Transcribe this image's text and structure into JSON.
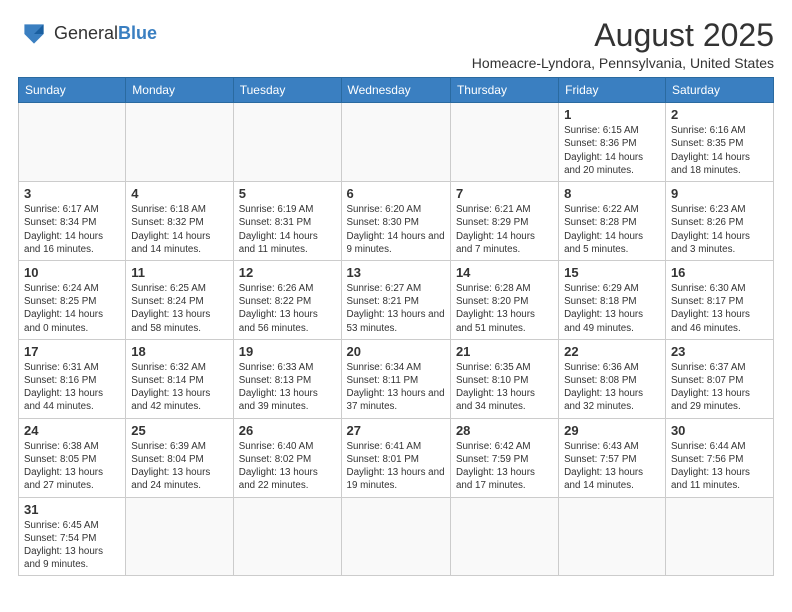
{
  "header": {
    "logo_general": "General",
    "logo_blue": "Blue",
    "month_year": "August 2025",
    "location": "Homeacre-Lyndora, Pennsylvania, United States"
  },
  "days_of_week": [
    "Sunday",
    "Monday",
    "Tuesday",
    "Wednesday",
    "Thursday",
    "Friday",
    "Saturday"
  ],
  "weeks": [
    [
      {
        "day": "",
        "info": ""
      },
      {
        "day": "",
        "info": ""
      },
      {
        "day": "",
        "info": ""
      },
      {
        "day": "",
        "info": ""
      },
      {
        "day": "",
        "info": ""
      },
      {
        "day": "1",
        "info": "Sunrise: 6:15 AM\nSunset: 8:36 PM\nDaylight: 14 hours and 20 minutes."
      },
      {
        "day": "2",
        "info": "Sunrise: 6:16 AM\nSunset: 8:35 PM\nDaylight: 14 hours and 18 minutes."
      }
    ],
    [
      {
        "day": "3",
        "info": "Sunrise: 6:17 AM\nSunset: 8:34 PM\nDaylight: 14 hours and 16 minutes."
      },
      {
        "day": "4",
        "info": "Sunrise: 6:18 AM\nSunset: 8:32 PM\nDaylight: 14 hours and 14 minutes."
      },
      {
        "day": "5",
        "info": "Sunrise: 6:19 AM\nSunset: 8:31 PM\nDaylight: 14 hours and 11 minutes."
      },
      {
        "day": "6",
        "info": "Sunrise: 6:20 AM\nSunset: 8:30 PM\nDaylight: 14 hours and 9 minutes."
      },
      {
        "day": "7",
        "info": "Sunrise: 6:21 AM\nSunset: 8:29 PM\nDaylight: 14 hours and 7 minutes."
      },
      {
        "day": "8",
        "info": "Sunrise: 6:22 AM\nSunset: 8:28 PM\nDaylight: 14 hours and 5 minutes."
      },
      {
        "day": "9",
        "info": "Sunrise: 6:23 AM\nSunset: 8:26 PM\nDaylight: 14 hours and 3 minutes."
      }
    ],
    [
      {
        "day": "10",
        "info": "Sunrise: 6:24 AM\nSunset: 8:25 PM\nDaylight: 14 hours and 0 minutes."
      },
      {
        "day": "11",
        "info": "Sunrise: 6:25 AM\nSunset: 8:24 PM\nDaylight: 13 hours and 58 minutes."
      },
      {
        "day": "12",
        "info": "Sunrise: 6:26 AM\nSunset: 8:22 PM\nDaylight: 13 hours and 56 minutes."
      },
      {
        "day": "13",
        "info": "Sunrise: 6:27 AM\nSunset: 8:21 PM\nDaylight: 13 hours and 53 minutes."
      },
      {
        "day": "14",
        "info": "Sunrise: 6:28 AM\nSunset: 8:20 PM\nDaylight: 13 hours and 51 minutes."
      },
      {
        "day": "15",
        "info": "Sunrise: 6:29 AM\nSunset: 8:18 PM\nDaylight: 13 hours and 49 minutes."
      },
      {
        "day": "16",
        "info": "Sunrise: 6:30 AM\nSunset: 8:17 PM\nDaylight: 13 hours and 46 minutes."
      }
    ],
    [
      {
        "day": "17",
        "info": "Sunrise: 6:31 AM\nSunset: 8:16 PM\nDaylight: 13 hours and 44 minutes."
      },
      {
        "day": "18",
        "info": "Sunrise: 6:32 AM\nSunset: 8:14 PM\nDaylight: 13 hours and 42 minutes."
      },
      {
        "day": "19",
        "info": "Sunrise: 6:33 AM\nSunset: 8:13 PM\nDaylight: 13 hours and 39 minutes."
      },
      {
        "day": "20",
        "info": "Sunrise: 6:34 AM\nSunset: 8:11 PM\nDaylight: 13 hours and 37 minutes."
      },
      {
        "day": "21",
        "info": "Sunrise: 6:35 AM\nSunset: 8:10 PM\nDaylight: 13 hours and 34 minutes."
      },
      {
        "day": "22",
        "info": "Sunrise: 6:36 AM\nSunset: 8:08 PM\nDaylight: 13 hours and 32 minutes."
      },
      {
        "day": "23",
        "info": "Sunrise: 6:37 AM\nSunset: 8:07 PM\nDaylight: 13 hours and 29 minutes."
      }
    ],
    [
      {
        "day": "24",
        "info": "Sunrise: 6:38 AM\nSunset: 8:05 PM\nDaylight: 13 hours and 27 minutes."
      },
      {
        "day": "25",
        "info": "Sunrise: 6:39 AM\nSunset: 8:04 PM\nDaylight: 13 hours and 24 minutes."
      },
      {
        "day": "26",
        "info": "Sunrise: 6:40 AM\nSunset: 8:02 PM\nDaylight: 13 hours and 22 minutes."
      },
      {
        "day": "27",
        "info": "Sunrise: 6:41 AM\nSunset: 8:01 PM\nDaylight: 13 hours and 19 minutes."
      },
      {
        "day": "28",
        "info": "Sunrise: 6:42 AM\nSunset: 7:59 PM\nDaylight: 13 hours and 17 minutes."
      },
      {
        "day": "29",
        "info": "Sunrise: 6:43 AM\nSunset: 7:57 PM\nDaylight: 13 hours and 14 minutes."
      },
      {
        "day": "30",
        "info": "Sunrise: 6:44 AM\nSunset: 7:56 PM\nDaylight: 13 hours and 11 minutes."
      }
    ],
    [
      {
        "day": "31",
        "info": "Sunrise: 6:45 AM\nSunset: 7:54 PM\nDaylight: 13 hours and 9 minutes."
      },
      {
        "day": "",
        "info": ""
      },
      {
        "day": "",
        "info": ""
      },
      {
        "day": "",
        "info": ""
      },
      {
        "day": "",
        "info": ""
      },
      {
        "day": "",
        "info": ""
      },
      {
        "day": "",
        "info": ""
      }
    ]
  ]
}
